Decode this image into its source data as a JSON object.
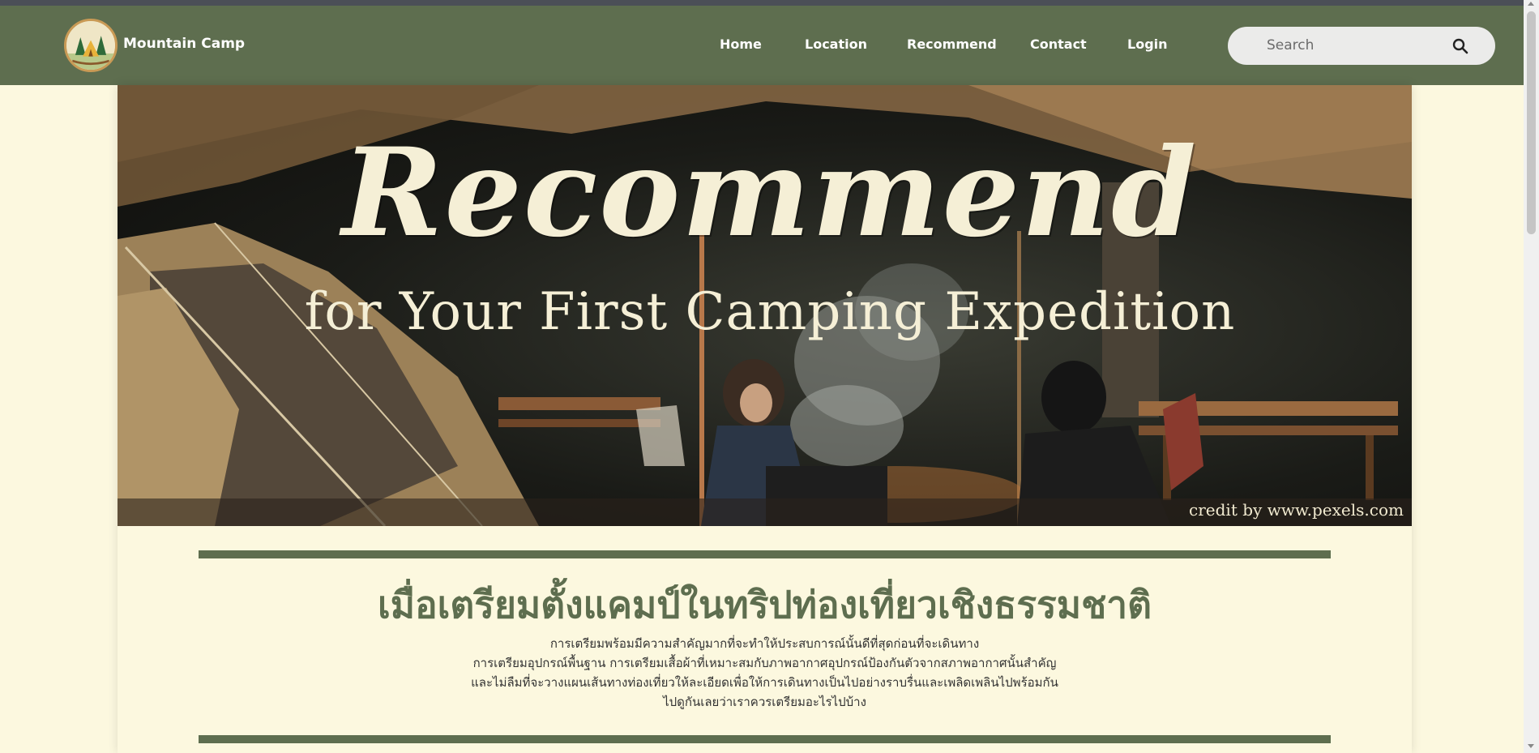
{
  "header": {
    "brand": "Mountain Camp",
    "nav": [
      "Home",
      "Location",
      "Recommend",
      "Contact",
      "Login"
    ],
    "search_placeholder": "Search"
  },
  "hero": {
    "title": "Recommend",
    "subtitle": "for Your First Camping Expedition",
    "credit": "credit by www.pexels.com"
  },
  "intro": {
    "heading": "เมื่อเตรียมตั้งแคมป์ในทริปท่องเที่ยวเชิงธรรมชาติ",
    "lines": [
      "การเตรียมพร้อมมีความสำคัญมากที่จะทำให้ประสบการณ์นั้นดีที่สุดก่อนที่จะเดินทาง",
      "การเตรียมอุปกรณ์พื้นฐาน การเตรียมเสื้อผ้าที่เหมาะสมกับภาพอากาศอุปกรณ์ป้องกันตัวจากสภาพอากาศนั้นสำคัญ",
      "และไม่ลืมที่จะวางแผนเส้นทางท่องเที่ยวให้ละเอียดเพื่อให้การเดินทางเป็นไปอย่างราบรื่นและเพลิดเพลินไปพร้อมกัน",
      "ไปดูกันเลยว่าเราควรเตรียมอะไรไปบ้าง"
    ]
  },
  "colors": {
    "nav_bg": "#5e6e4f",
    "page_bg": "#fcf8df",
    "accent": "#5e6e4f"
  },
  "icons": {
    "search": "search-icon",
    "logo": "camp-logo-icon"
  }
}
